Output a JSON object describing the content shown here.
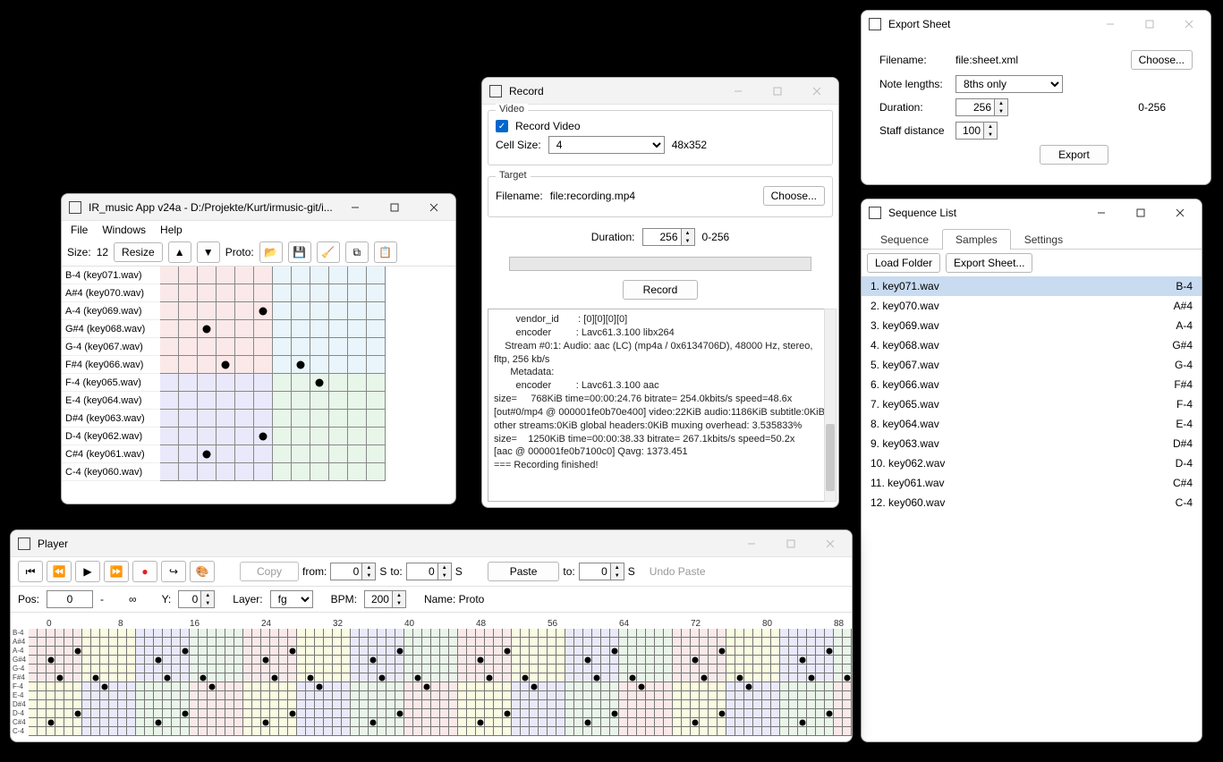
{
  "main_window": {
    "title": "IR_music App v24a - D:/Projekte/Kurt/irmusic-git/i...",
    "menus": [
      "File",
      "Windows",
      "Help"
    ],
    "size_label": "Size:",
    "size_value": "12",
    "resize_btn": "Resize",
    "proto_label": "Proto:",
    "rows": [
      "B-4 (key071.wav)",
      "A#4 (key070.wav)",
      "A-4 (key069.wav)",
      "G#4 (key068.wav)",
      "G-4 (key067.wav)",
      "F#4 (key066.wav)",
      "F-4 (key065.wav)",
      "E-4 (key064.wav)",
      "D#4 (key063.wav)",
      "D-4 (key062.wav)",
      "C#4 (key061.wav)",
      "C-4 (key060.wav)"
    ],
    "grid_cols": 12,
    "notes": [
      [
        2,
        5
      ],
      [
        3,
        2
      ],
      [
        5,
        3
      ],
      [
        5,
        7
      ],
      [
        6,
        8
      ],
      [
        9,
        5
      ],
      [
        10,
        2
      ]
    ],
    "regions_top": [
      [
        0,
        6,
        "region1"
      ],
      [
        6,
        12,
        "region4"
      ]
    ],
    "regions_bot": [
      [
        0,
        6,
        "region2"
      ],
      [
        6,
        12,
        "region3"
      ]
    ]
  },
  "record_window": {
    "title": "Record",
    "video_group": "Video",
    "record_video_label": "Record Video",
    "cell_size_label": "Cell Size:",
    "cell_size_value": "4",
    "cell_dims": "48x352",
    "target_group": "Target",
    "filename_label": "Filename:",
    "filename_value": "file:recording.mp4",
    "choose_btn": "Choose...",
    "duration_label": "Duration:",
    "duration_value": "256",
    "duration_range": "0-256",
    "record_btn": "Record",
    "log": "        vendor_id       : [0][0][0][0]\n        encoder         : Lavc61.3.100 libx264\n    Stream #0:1: Audio: aac (LC) (mp4a / 0x6134706D), 48000 Hz, stereo, fltp, 256 kb/s\n      Metadata:\n        encoder         : Lavc61.3.100 aac\nsize=     768KiB time=00:00:24.76 bitrate= 254.0kbits/s speed=48.6x\n[out#0/mp4 @ 000001fe0b70e400] video:22KiB audio:1186KiB subtitle:0KiB other streams:0KiB global headers:0KiB muxing overhead: 3.535833%\nsize=    1250KiB time=00:00:38.33 bitrate= 267.1kbits/s speed=50.2x\n[aac @ 000001fe0b7100c0] Qavg: 1373.451\n=== Recording finished!"
  },
  "export_window": {
    "title": "Export Sheet",
    "filename_label": "Filename:",
    "filename_value": "file:sheet.xml",
    "choose_btn": "Choose...",
    "note_lengths_label": "Note lengths:",
    "note_lengths_value": "8ths only",
    "duration_label": "Duration:",
    "duration_value": "256",
    "duration_range": "0-256",
    "staff_label": "Staff distance",
    "staff_value": "100",
    "export_btn": "Export"
  },
  "sequence_window": {
    "title": "Sequence List",
    "tabs": [
      "Sequence",
      "Samples",
      "Settings"
    ],
    "active_tab": 1,
    "load_folder_btn": "Load Folder",
    "export_sheet_btn": "Export Sheet...",
    "items": [
      {
        "idx": "1.",
        "file": "key071.wav",
        "note": "B-4",
        "sel": true
      },
      {
        "idx": "2.",
        "file": "key070.wav",
        "note": "A#4"
      },
      {
        "idx": "3.",
        "file": "key069.wav",
        "note": "A-4"
      },
      {
        "idx": "4.",
        "file": "key068.wav",
        "note": "G#4"
      },
      {
        "idx": "5.",
        "file": "key067.wav",
        "note": "G-4"
      },
      {
        "idx": "6.",
        "file": "key066.wav",
        "note": "F#4"
      },
      {
        "idx": "7.",
        "file": "key065.wav",
        "note": "F-4"
      },
      {
        "idx": "8.",
        "file": "key064.wav",
        "note": "E-4"
      },
      {
        "idx": "9.",
        "file": "key063.wav",
        "note": "D#4"
      },
      {
        "idx": "10.",
        "file": "key062.wav",
        "note": "D-4"
      },
      {
        "idx": "11.",
        "file": "key061.wav",
        "note": "C#4"
      },
      {
        "idx": "12.",
        "file": "key060.wav",
        "note": "C-4"
      }
    ]
  },
  "player_window": {
    "title": "Player",
    "copy_btn": "Copy",
    "from_label": "from:",
    "from_value": "0",
    "to_label": "to:",
    "to_value": "0",
    "paste_btn": "Paste",
    "paste_to_label": "to:",
    "paste_to_value": "0",
    "undo_paste_btn": "Undo Paste",
    "pos_label": "Pos:",
    "pos_value": "0",
    "dash": "-",
    "infinity": "∞",
    "y_label": "Y:",
    "y_value": "0",
    "layer_label": "Layer:",
    "layer_value": "fg",
    "bpm_label": "BPM:",
    "bpm_value": "200",
    "name_label": "Name: Proto",
    "row_labels": [
      "B-4",
      "A#4",
      "A-4",
      "G#4",
      "G-4",
      "F#4",
      "F-4",
      "E-4",
      "D#4",
      "D-4",
      "C#4",
      "C-4"
    ],
    "ruler_marks": [
      0,
      8,
      16,
      24,
      32,
      40,
      48,
      56,
      64,
      72,
      80,
      88
    ],
    "grid_cols": 92,
    "pattern_len": 12,
    "notes_pattern": [
      [
        2,
        5
      ],
      [
        3,
        2
      ],
      [
        5,
        3
      ],
      [
        5,
        7
      ],
      [
        6,
        8
      ],
      [
        9,
        5
      ],
      [
        10,
        2
      ]
    ]
  }
}
